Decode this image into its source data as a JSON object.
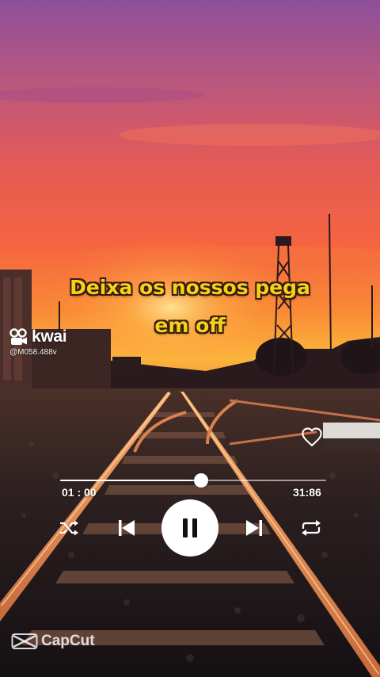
{
  "lyrics": {
    "line1": "Deixa os nossos pega",
    "line2": "em off"
  },
  "watermark": {
    "kwai_name": "kwai",
    "kwai_user": "@M058.488v",
    "capcut_name": "CapCut"
  },
  "player": {
    "elapsed": "01 : 00",
    "total": "31:86",
    "progress_fraction": 0.53,
    "liked": false,
    "state": "playing"
  },
  "icons": [
    "heart-icon",
    "shuffle-icon",
    "previous-icon",
    "pause-icon",
    "next-icon",
    "repeat-icon",
    "kwai-logo-icon",
    "capcut-logo-icon"
  ],
  "colors": {
    "lyric_text": "#f3d21a",
    "lyric_outline": "#3a1a10",
    "control_fg": "#ffffff"
  }
}
